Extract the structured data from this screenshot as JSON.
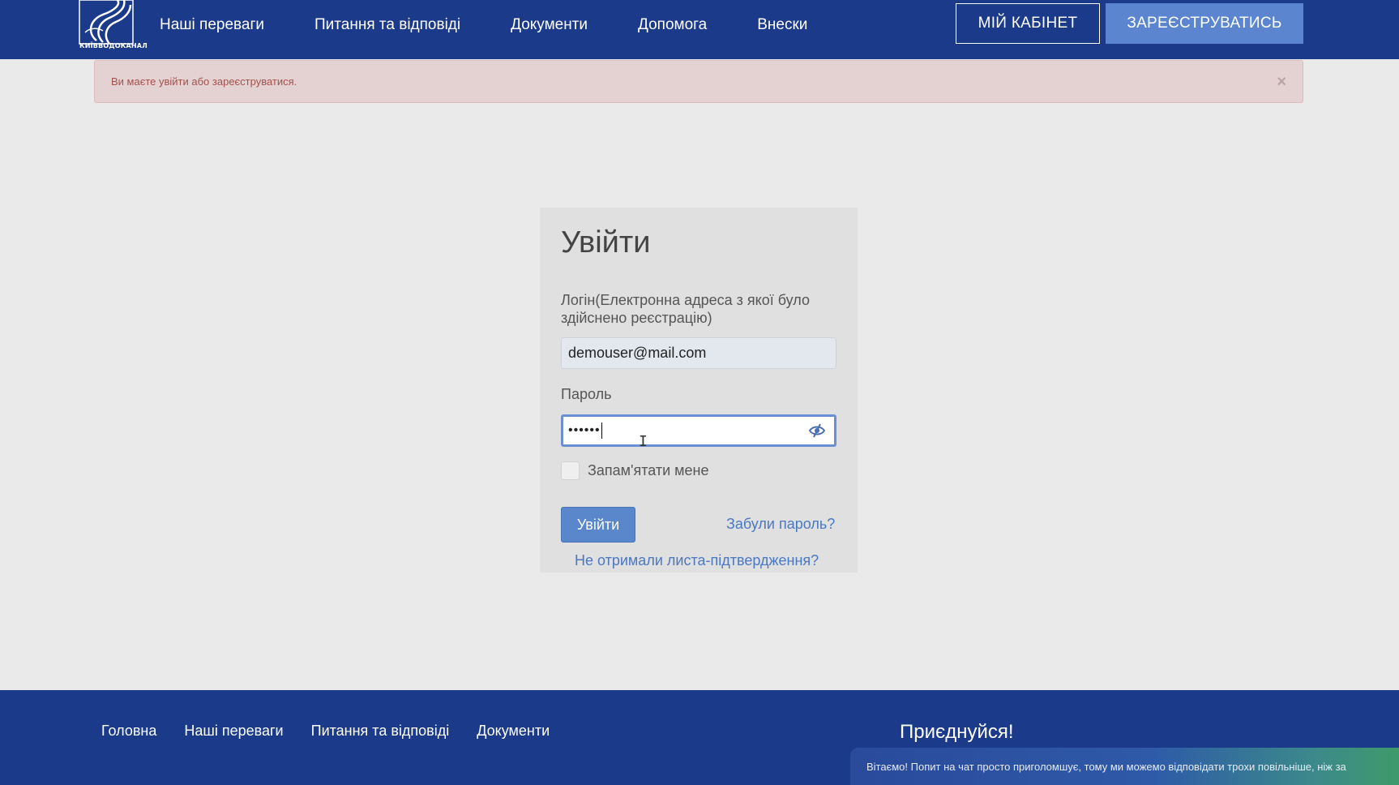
{
  "header": {
    "logo_text": "КИЇВВОДОКАНАЛ",
    "nav": [
      "Наші переваги",
      "Питання та відповіді",
      "Документи",
      "Допомога",
      "Внески"
    ],
    "cabinet_label": "МІЙ КАБІНЕТ",
    "register_label": "ЗАРЕЄСТРУВАТИСЬ"
  },
  "alert": {
    "text": "Ви маєте увійти або зареєструватися.",
    "close_symbol": "×"
  },
  "login": {
    "title": "Увійти",
    "login_label": "Логін(Електронна адреса з якої було здійснено реєстрацію)",
    "login_value": "demouser@mail.com",
    "password_label": "Пароль",
    "password_value": "••••••",
    "remember_label": "Запам'ятати мене",
    "submit_label": "Увійти",
    "forgot_label": "Забули пароль?",
    "resend_label": "Не отримали листа-підтвердження?"
  },
  "footer": {
    "nav": [
      "Головна",
      "Наші переваги",
      "Питання та відповіді",
      "Документи"
    ],
    "join_text": "Приєднуйся!",
    "chat_text": "Вітаємо! Попит на чат просто приголомшує, тому ми можемо відповідати трохи повільніше, ніж за"
  },
  "colors": {
    "header_bg": "#1b3a8a",
    "accent": "#5b86cf",
    "alert_bg": "#e4d2d2",
    "alert_text": "#a3504b",
    "link": "#4a78c0"
  },
  "icons": {
    "eye": "eye-slash-icon",
    "logo": "kyivvodokanal-logo"
  }
}
